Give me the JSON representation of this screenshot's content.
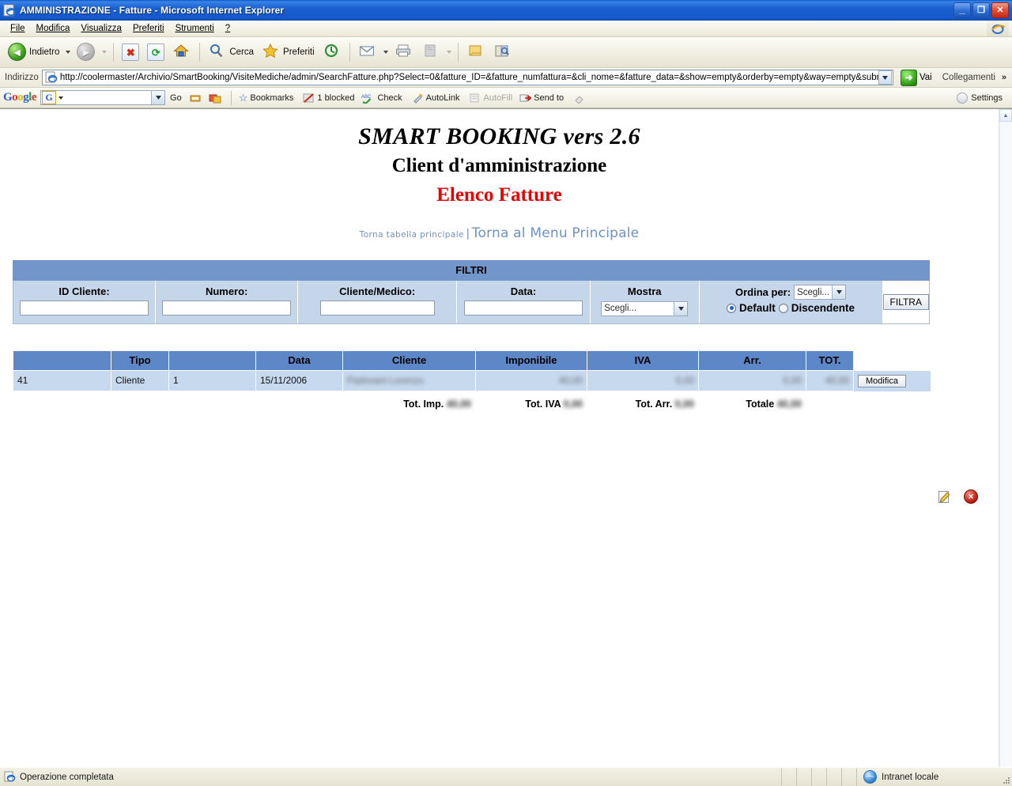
{
  "window": {
    "title": "AMMINISTRAZIONE - Fatture - Microsoft Internet Explorer",
    "minimize_label": "_",
    "maximize_label": "❐",
    "close_label": "✕"
  },
  "menubar": {
    "items": [
      {
        "label": "File"
      },
      {
        "label": "Modifica"
      },
      {
        "label": "Visualizza"
      },
      {
        "label": "Preferiti"
      },
      {
        "label": "Strumenti"
      },
      {
        "label": "?"
      }
    ]
  },
  "toolbar": {
    "back_label": "Indietro",
    "forward_label": "",
    "stop_label": "",
    "refresh_label": "",
    "home_label": "",
    "search_label": "Cerca",
    "favorites_label": "Preferiti",
    "history_label": "",
    "mail_label": "",
    "print_label": "",
    "edit_label": "",
    "discuss_label": "",
    "research_label": ""
  },
  "address": {
    "label": "Indirizzo",
    "url": "http://coolermaster/Archivio/SmartBooking/VisiteMediche/admin/SearchFatture.php?Select=0&fatture_ID=&fatture_numfattura=&cli_nome=&fatture_data=&show=empty&orderby=empty&way=empty&submit=FIL",
    "go_label": "Vai",
    "links_label": "Collegamenti",
    "overflow_label": "»"
  },
  "google_toolbar": {
    "logo": {
      "g1": "G",
      "o1": "o",
      "o2": "o",
      "g2": "g",
      "l": "l",
      "e": "e"
    },
    "search_value": "",
    "search_badge": "G",
    "go_label": "Go",
    "bookmarks_label": "Bookmarks",
    "blocked_label": "1 blocked",
    "check_label": "Check",
    "autolink_label": "AutoLink",
    "autofill_label": "AutoFill",
    "sendto_label": "Send to",
    "settings_label": "Settings"
  },
  "page": {
    "title_app": "SMART BOOKING vers 2.6",
    "title_sub": "Client d'amministrazione",
    "title_section": "Elenco Fatture",
    "link_small": "Torna tabella principale",
    "link_separator": "|",
    "link_big": "Torna al Menu Principale",
    "colors": {
      "section_title": "#ec0000",
      "header_blue": "#5d87c6",
      "panel_blue": "#c6d6ea",
      "link_blue": "#6f92c4"
    }
  },
  "filters": {
    "title": "FILTRI",
    "id_cliente_label": "ID Cliente:",
    "id_cliente_value": "",
    "numero_label": "Numero:",
    "numero_value": "",
    "cliente_medico_label": "Cliente/Medico:",
    "cliente_medico_value": "",
    "data_label": "Data:",
    "data_value": "",
    "mostra_label": "Mostra",
    "mostra_value": "Scegli...",
    "ordina_label": "Ordina per:",
    "ordina_value": "Scegli...",
    "radio_default_label": "Default",
    "radio_discendente_label": "Discendente",
    "radio_selected": "Default",
    "filtra_button": "FILTRA"
  },
  "table": {
    "columns": [
      "",
      "Tipo",
      "",
      "Data",
      "Cliente",
      "Imponibile",
      "IVA",
      "Arr.",
      "TOT.",
      ""
    ],
    "rows": [
      {
        "id": "41",
        "tipo": "Cliente",
        "numero": "1",
        "data": "15/11/2006",
        "cliente": "Padovani Lorenzo",
        "imponibile": "40,00",
        "iva": "0,00",
        "arr": "0,00",
        "tot": "40,00",
        "modifica_label": "Modifica",
        "edit_icon": "pencil-icon",
        "delete_icon": "delete-icon"
      }
    ],
    "totals": {
      "imp_label": "Tot. Imp.",
      "imp_value": "40,00",
      "iva_label": "Tot. IVA",
      "iva_value": "0,00",
      "arr_label": "Tot. Arr.",
      "arr_value": "0,00",
      "tot_label": "Totale",
      "tot_value": "40,00"
    }
  },
  "statusbar": {
    "message": "Operazione completata",
    "zone": "Intranet locale"
  }
}
